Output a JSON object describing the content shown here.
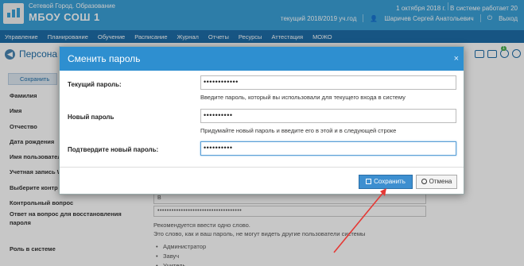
{
  "header": {
    "org_city": "Сетевой Город. Образование",
    "org_name": "МБОУ СОШ 1",
    "date_text": "1 октября 2018 г.",
    "online_text": "В системе работает 20",
    "year_text": "текущий 2018/2019 уч.год",
    "user_name": "Шаричев Сергей Анатольевич",
    "logout_label": "Выход"
  },
  "nav": {
    "items": [
      "Управление",
      "Планирование",
      "Обучение",
      "Расписание",
      "Журнал",
      "Отчеты",
      "Ресурсы",
      "Аттестация",
      "МОЖО"
    ]
  },
  "page": {
    "title": "Персона",
    "save_label": "Сохранить",
    "badge_count": "1",
    "labels": [
      "Фамилия",
      "Имя",
      "Отчество",
      "Дата рождения",
      "Имя пользователя",
      "Учетная запись W",
      "Выберите контр",
      "Контрольный вопрос"
    ],
    "answer_label": "Ответ на вопрос для восстановления пароля",
    "answer_value": "••••••••••••••••••••••••••••••••••••",
    "question_value": "В",
    "hint_line1": "Рекомендуется ввести одно слово.",
    "hint_line2": "Это слово, как и ваш пароль, не могут видеть другие пользователи системы",
    "role_label": "Роль в системе",
    "roles": [
      "Администратор",
      "Завуч",
      "Учитель"
    ]
  },
  "modal": {
    "title": "Сменить пароль",
    "close_label": "×",
    "current_password": {
      "label": "Текущий пароль:",
      "value": "••••••••••••",
      "hint": "Введите пароль, который вы использовали для текущего входа в систему"
    },
    "new_password": {
      "label": "Новый пароль",
      "value": "••••••••••",
      "hint": "Придумайте новый пароль и введите его в этой и в следующей строке"
    },
    "confirm_password": {
      "label": "Подтвердите новый пароль:",
      "value": "••••••••••"
    },
    "save_label": "Сохранить",
    "cancel_label": "Отмена"
  },
  "colors": {
    "header_bg": "#3aa0d8",
    "nav_bg": "#1e6ea8",
    "modal_header_bg": "#2e8fd0",
    "arrow": "#e53935"
  }
}
